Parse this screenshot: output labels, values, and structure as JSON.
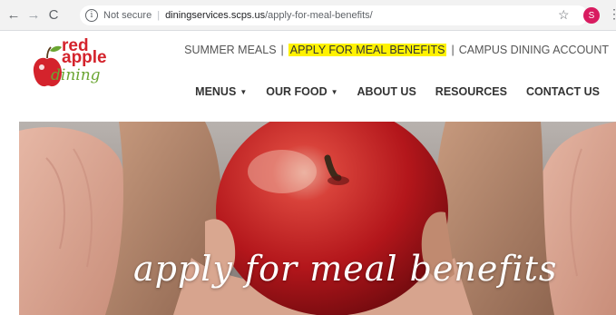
{
  "browser": {
    "security_label": "Not secure",
    "url_host": "diningservices.scps.us",
    "url_path": "/apply-for-meal-benefits/",
    "profile_initial": "S",
    "icons": [
      "back-arrow-icon",
      "forward-arrow-icon",
      "reload-icon",
      "info-icon",
      "star-icon",
      "kebab-menu-icon"
    ]
  },
  "logo": {
    "line1": "red",
    "line2": "apple",
    "line3": "dining"
  },
  "utility_nav": {
    "items": [
      "SUMMER MEALS",
      "APPLY FOR MEAL BENEFITS",
      "CAMPUS DINING ACCOUNT"
    ],
    "separator": "|",
    "highlight_color": "#fff200"
  },
  "main_nav": {
    "items": [
      "MENUS",
      "OUR FOOD",
      "ABOUT US",
      "RESOURCES",
      "CONTACT US"
    ]
  },
  "hero": {
    "title": "apply for meal benefits"
  },
  "colors": {
    "brand_red": "#d4232c",
    "brand_green": "#6aa532"
  }
}
